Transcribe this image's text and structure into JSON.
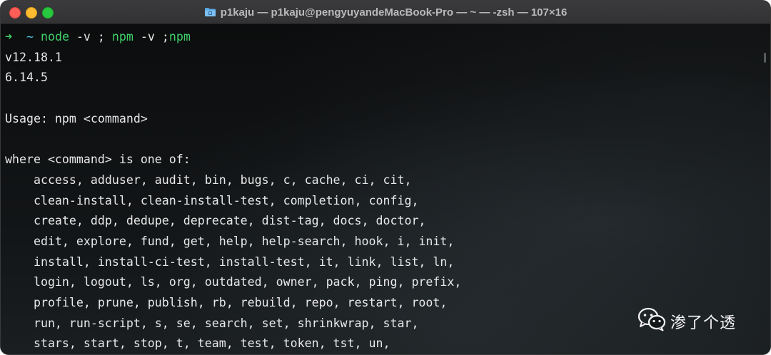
{
  "window": {
    "title": "p1kaju — p1kaju@pengyuyandeMacBook-Pro — ~ — -zsh — 107×16"
  },
  "icons": {
    "close": "close-icon",
    "minimize": "minimize-icon",
    "maximize": "zoom-icon",
    "title_folder": "folder-icon",
    "watermark": "wechat-icon"
  },
  "colors": {
    "close": "#ff5f57",
    "minimize": "#febc2e",
    "maximize": "#28c840",
    "prompt_arrow": "#3fd26b",
    "prompt_tilde": "#55c8e8",
    "terminal_text": "#e8e8e8"
  },
  "terminal": {
    "prompt": {
      "arrow": "➜",
      "dir": "~",
      "cmd_node": "node",
      "cmd_node_args": " -v ; ",
      "cmd_npm1": "npm",
      "cmd_npm1_args": " -v ;",
      "cmd_npm2": "npm"
    },
    "lines": [
      "v12.18.1",
      "6.14.5",
      "",
      "Usage: npm <command>",
      "",
      "where <command> is one of:",
      "    access, adduser, audit, bin, bugs, c, cache, ci, cit,",
      "    clean-install, clean-install-test, completion, config,",
      "    create, ddp, dedupe, deprecate, dist-tag, docs, doctor,",
      "    edit, explore, fund, get, help, help-search, hook, i, init,",
      "    install, install-ci-test, install-test, it, link, list, ln,",
      "    login, logout, ls, org, outdated, owner, pack, ping, prefix,",
      "    profile, prune, publish, rb, rebuild, repo, restart, root,",
      "    run, run-script, s, se, search, set, shrinkwrap, star,",
      "    stars, start, stop, t, team, test, token, tst, un,"
    ]
  },
  "watermark": {
    "text": "渗了个透"
  }
}
